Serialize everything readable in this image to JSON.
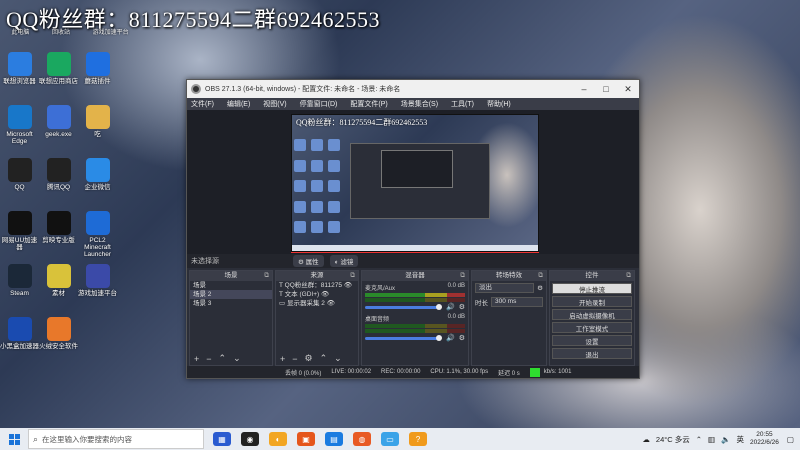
{
  "desktop": {
    "banner": "QQ粉丝群：811275594二群692462553",
    "top_labels": [
      "此电脑",
      "回收站",
      "游戏加速平台"
    ],
    "icons": [
      {
        "label": "联想浏览器",
        "icon": "edge-like-icon",
        "color": "#2b7de0"
      },
      {
        "label": "联想应用商店",
        "icon": "store-icon",
        "color": "#1aa860"
      },
      {
        "label": "蘑菇插件",
        "icon": "mushroom-icon",
        "color": "#1f6fe0"
      },
      {
        "label": "Microsoft Edge",
        "icon": "edge-icon",
        "color": "#1877c9"
      },
      {
        "label": "geek.exe",
        "icon": "geek-icon",
        "color": "#3d6fd6"
      },
      {
        "label": "吃",
        "icon": "folder-icon",
        "color": "#e3b34a"
      },
      {
        "label": "QQ",
        "icon": "qq-icon",
        "color": "#222"
      },
      {
        "label": "腾讯QQ",
        "icon": "tencent-qq-icon",
        "color": "#222"
      },
      {
        "label": "企业微信",
        "icon": "wecom-icon",
        "color": "#2a8be6"
      },
      {
        "label": "网易UU加速器",
        "icon": "uu-icon",
        "color": "#111"
      },
      {
        "label": "剪映专业版",
        "icon": "capcut-icon",
        "color": "#111"
      },
      {
        "label": "PCL2 Minecraft Launcher",
        "icon": "pcl-icon",
        "color": "#1e6bd6"
      },
      {
        "label": "Steam",
        "icon": "steam-icon",
        "color": "#1b2838"
      },
      {
        "label": "素材",
        "icon": "file-icon",
        "color": "#d9c23a"
      },
      {
        "label": "游戏加速平台",
        "icon": "game-icon",
        "color": "#3b4aa8"
      },
      {
        "label": "小黑盒加速器",
        "icon": "heybox-icon",
        "color": "#1a4bb0"
      },
      {
        "label": "火绒安全软件",
        "icon": "huorong-icon",
        "color": "#e8782a"
      }
    ]
  },
  "obs": {
    "title": "OBS 27.1.3 (64-bit, windows) - 配置文件: 未命名 - 场景: 未命名",
    "menu": [
      "文件(F)",
      "编辑(E)",
      "视图(V)",
      "停靠窗口(D)",
      "配置文件(P)",
      "场景集合(S)",
      "工具(T)",
      "帮助(H)"
    ],
    "preview_text": "QQ粉丝群：811275594二群692462553",
    "no_source": "未选择源",
    "props_btn": "属性",
    "filters_btn": "滤镜",
    "docks": {
      "scenes": {
        "title": "场景",
        "items": [
          "场景",
          "场景 2",
          "场景 3"
        ]
      },
      "sources": {
        "title": "来源",
        "items": [
          "QQ粉丝群：811275",
          "文本 (GDI+)",
          "显示器采集 2"
        ]
      },
      "mixer": {
        "title": "混音器",
        "channels": [
          {
            "name": "麦克风/Aux",
            "db": "0.0 dB",
            "level": 0.85
          },
          {
            "name": "桌面音频",
            "db": "0.0 dB",
            "level": 0.85
          }
        ]
      },
      "transitions": {
        "title": "转场特效",
        "type": "淡出",
        "duration_label": "时长",
        "duration": "300 ms"
      },
      "controls": {
        "title": "控件",
        "buttons": [
          "停止推流",
          "开始录制",
          "启动虚拟摄像机",
          "工作室模式",
          "设置",
          "退出"
        ]
      }
    },
    "status": {
      "dropped": "丢帧 0 (0.0%)",
      "live": "LIVE: 00:00:02",
      "rec": "REC: 00:00:00",
      "cpu": "CPU: 1.1%, 30.00 fps",
      "stream_label": "延迟 0 s",
      "kbps": "kb/s: 1001"
    }
  },
  "taskbar": {
    "search_placeholder": "在这里输入你要搜索的内容",
    "weather": "24°C 多云",
    "lang": "英",
    "time": "20:55",
    "date": "2022/6/26"
  }
}
